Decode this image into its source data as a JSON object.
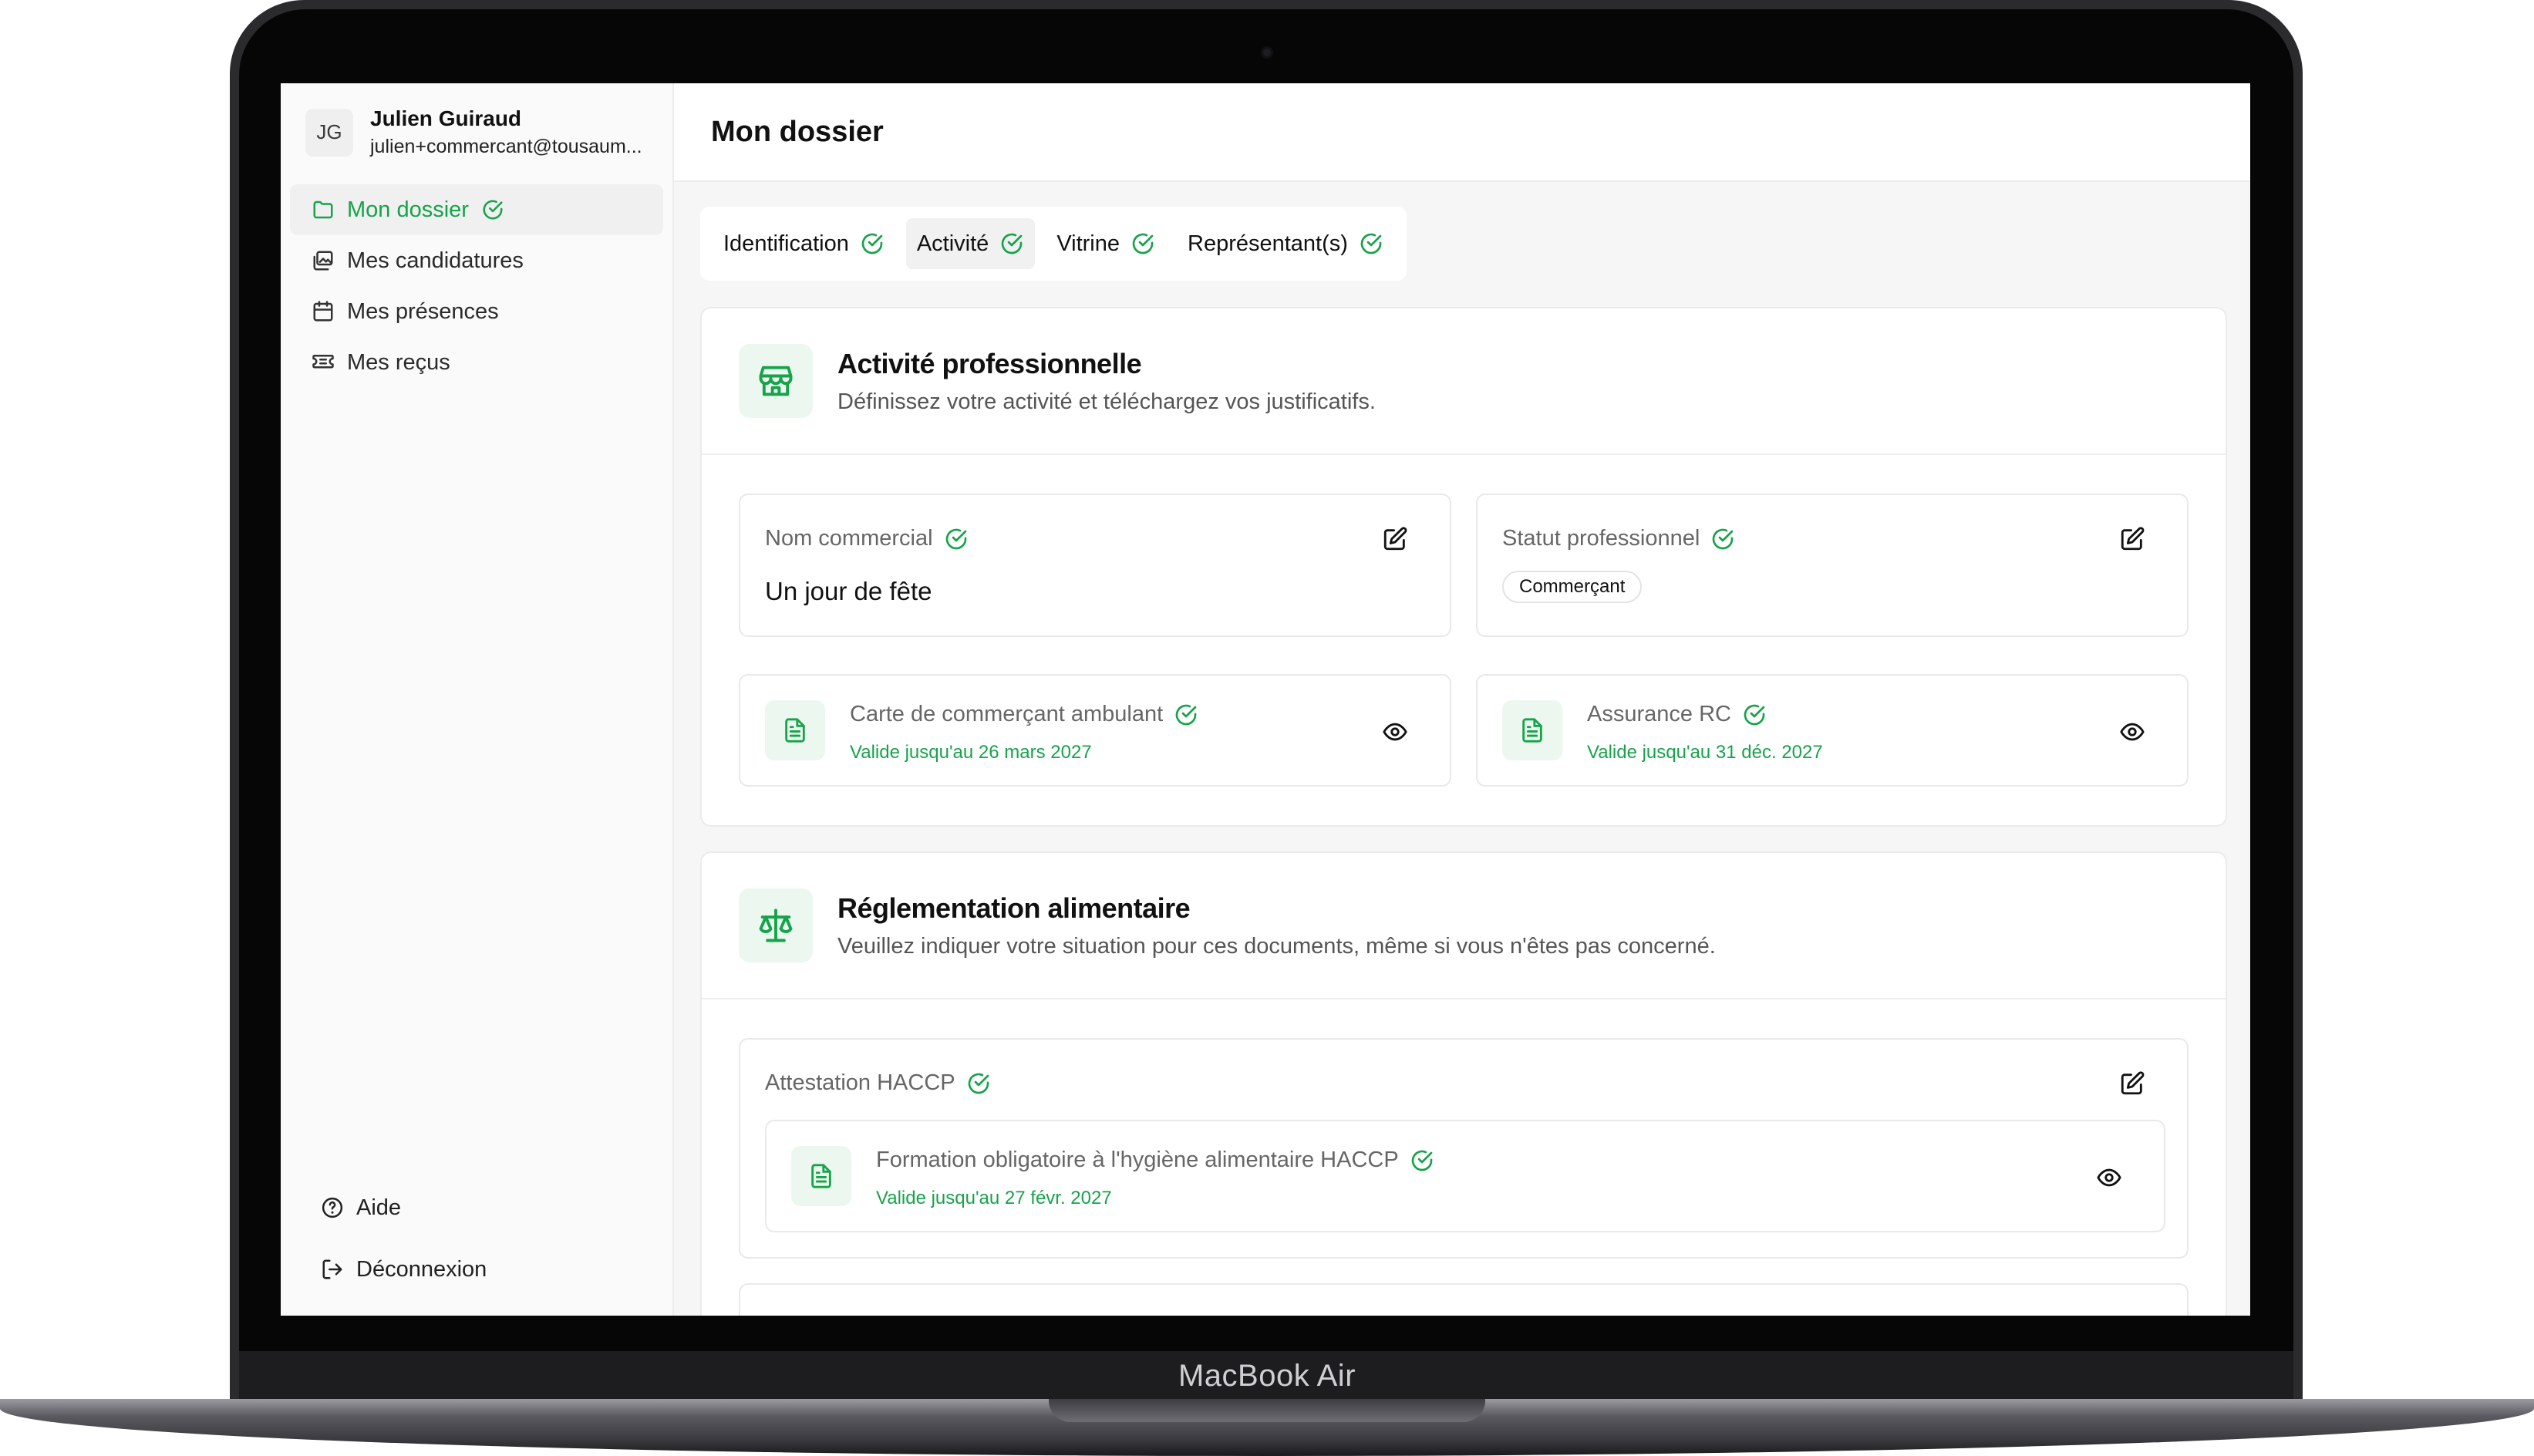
{
  "device": {
    "brand": "MacBook Air"
  },
  "user": {
    "initials": "JG",
    "name": "Julien Guiraud",
    "email": "julien+commercant@tousaum..."
  },
  "nav": {
    "items": [
      {
        "label": "Mon dossier",
        "icon": "folder-icon",
        "active": true,
        "checked": true
      },
      {
        "label": "Mes candidatures",
        "icon": "images-icon",
        "active": false
      },
      {
        "label": "Mes présences",
        "icon": "calendar-icon",
        "active": false
      },
      {
        "label": "Mes reçus",
        "icon": "ticket-icon",
        "active": false
      }
    ],
    "footer": [
      {
        "label": "Aide",
        "icon": "help-circle-icon"
      },
      {
        "label": "Déconnexion",
        "icon": "logout-icon"
      }
    ]
  },
  "page": {
    "title": "Mon dossier"
  },
  "tabs": [
    {
      "label": "Identification",
      "active": false
    },
    {
      "label": "Activité",
      "active": true
    },
    {
      "label": "Vitrine",
      "active": false
    },
    {
      "label": "Représentant(s)",
      "active": false
    }
  ],
  "activity": {
    "title": "Activité professionnelle",
    "subtitle": "Définissez votre activité et téléchargez vos justificatifs.",
    "trade_name": {
      "label": "Nom commercial",
      "value": "Un jour de fête"
    },
    "status": {
      "label": "Statut professionnel",
      "value": "Commerçant"
    },
    "docs": [
      {
        "title": "Carte de commerçant ambulant",
        "valid": "Valide jusqu'au 26 mars 2027"
      },
      {
        "title": "Assurance RC",
        "valid": "Valide jusqu'au 31 déc. 2027"
      }
    ]
  },
  "food": {
    "title": "Réglementation alimentaire",
    "subtitle": "Veuillez indiquer votre situation pour ces documents, même si vous n'êtes pas concerné.",
    "haccp": {
      "label": "Attestation HACCP",
      "doc_title": "Formation obligatoire à l'hygiène alimentaire HACCP",
      "doc_valid": "Valide jusqu'au 27 févr. 2027"
    }
  },
  "colors": {
    "accent": "#16a34a",
    "accent_bg": "#ecf8ef",
    "text": "#111111",
    "muted": "#666666"
  }
}
